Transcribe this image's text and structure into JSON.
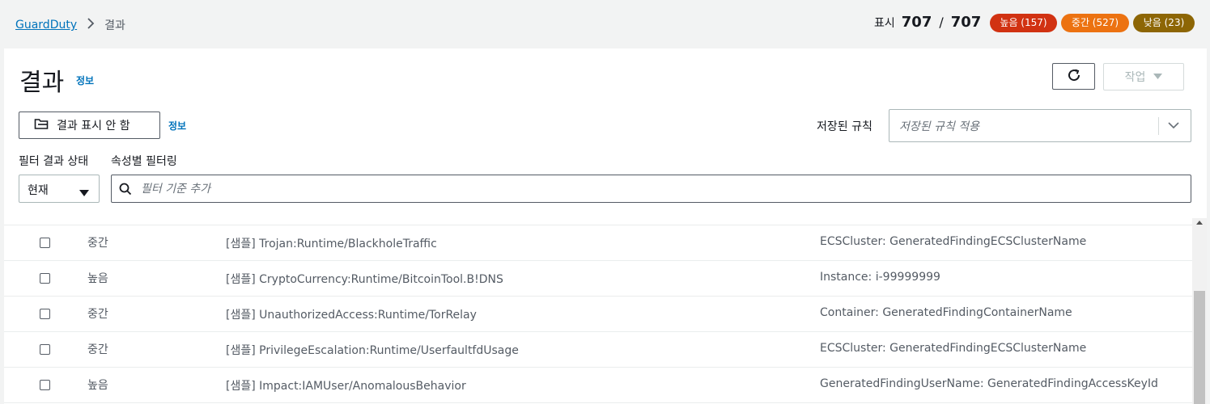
{
  "breadcrumb": {
    "root": "GuardDuty",
    "current": "결과"
  },
  "counter": {
    "label": "표시",
    "shown": "707",
    "separator": "/",
    "total": "707"
  },
  "badges": {
    "high": "높음 (157)",
    "medium": "중간 (527)",
    "low": "낮음 (23)"
  },
  "colors": {
    "high": "#d13212",
    "medium": "#ec7211",
    "low": "#8d6605",
    "link": "#0073bb"
  },
  "header": {
    "title": "결과",
    "info": "정보",
    "actions_label": "작업"
  },
  "toolbar": {
    "suppress_label": "결과 표시 안 함",
    "suppress_info": "정보",
    "saved_rules_label": "저장된 규칙",
    "saved_rules_placeholder": "저장된 규칙 적용"
  },
  "filters": {
    "status_label": "필터 결과 상태",
    "attr_label": "속성별 필터링",
    "status_value": "현재",
    "search_placeholder": "필터 기준 추가"
  },
  "rows": [
    {
      "severity": "중간",
      "finding": "[샘플] Trojan:Runtime/BlackholeTraffic",
      "resource": "ECSCluster: GeneratedFindingECSClusterName"
    },
    {
      "severity": "높음",
      "finding": "[샘플] CryptoCurrency:Runtime/BitcoinTool.B!DNS",
      "resource": "Instance: i-99999999"
    },
    {
      "severity": "중간",
      "finding": "[샘플] UnauthorizedAccess:Runtime/TorRelay",
      "resource": "Container: GeneratedFindingContainerName"
    },
    {
      "severity": "중간",
      "finding": "[샘플] PrivilegeEscalation:Runtime/UserfaultfdUsage",
      "resource": "ECSCluster: GeneratedFindingECSClusterName"
    },
    {
      "severity": "높음",
      "finding": "[샘플] Impact:IAMUser/AnomalousBehavior",
      "resource": "GeneratedFindingUserName: GeneratedFindingAccessKeyId"
    }
  ]
}
